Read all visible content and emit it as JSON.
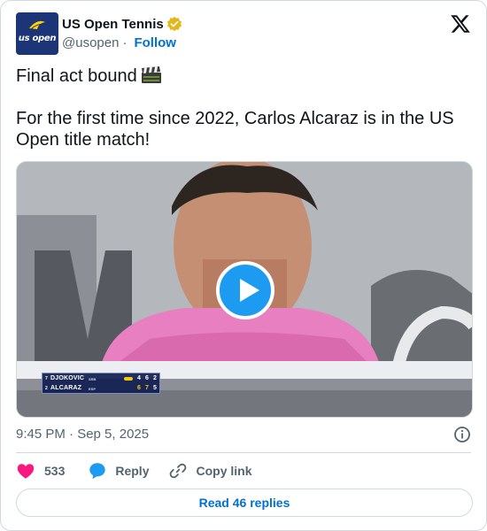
{
  "author": {
    "display_name": "US Open Tennis",
    "handle": "@usopen",
    "separator": "·",
    "follow_label": "Follow",
    "avatar_text": "us open",
    "verified_color": "#e2b719"
  },
  "tweet": {
    "line1": "Final act bound",
    "line2": "For the first time since 2022, Carlos Alcaraz is in the US Open title match!",
    "timestamp": "9:45 PM · Sep 5, 2025"
  },
  "video": {
    "scoreboard": {
      "rows": [
        {
          "seed": "7",
          "name": "DJOKOVIC",
          "country": "SRB",
          "sets": [
            "4",
            "6",
            "2"
          ]
        },
        {
          "seed": "2",
          "name": "ALCARAZ",
          "country": "ESP",
          "sets": [
            "6",
            "7",
            "5"
          ]
        }
      ]
    }
  },
  "actions": {
    "like_count": "533",
    "reply_label": "Reply",
    "copy_label": "Copy link",
    "read_replies": "Read 46 replies"
  },
  "colors": {
    "accent": "#1d9bf0",
    "link": "#006fd6",
    "like": "#f91880",
    "muted": "#536471",
    "border": "#cfd9de"
  }
}
